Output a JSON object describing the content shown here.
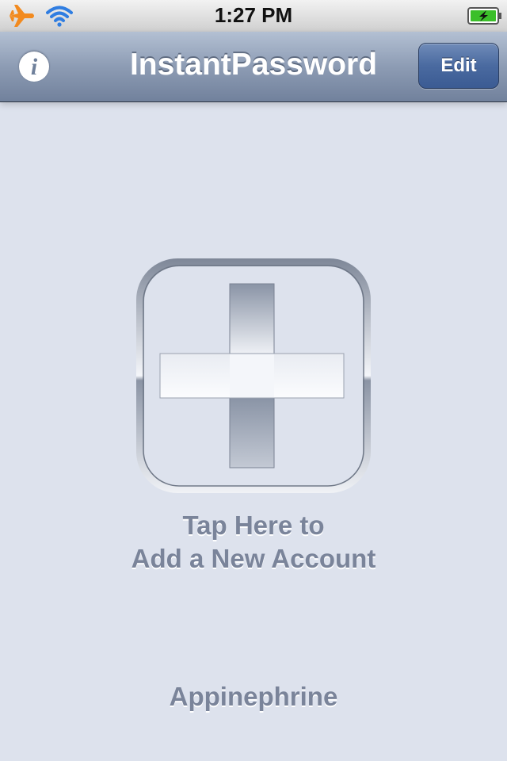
{
  "status_bar": {
    "time": "1:27 PM",
    "icons": [
      "airplane-icon",
      "wifi-icon",
      "battery-charging-icon"
    ]
  },
  "nav_bar": {
    "title": "InstantPassword",
    "info_button_icon": "info-icon",
    "edit_label": "Edit"
  },
  "main": {
    "add_icon": "plus-icon",
    "prompt_line_1": "Tap Here to",
    "prompt_line_2": "Add a New Account"
  },
  "footer": {
    "brand": "Appinephrine"
  },
  "colors": {
    "background": "#dde2ed",
    "nav_bar": "#8d9cb4",
    "edit_button": "#4a6aa0",
    "airplane": "#f28a1e",
    "wifi": "#2f7de1",
    "battery": "#3bbf2a",
    "muted_text": "#7a849a"
  }
}
